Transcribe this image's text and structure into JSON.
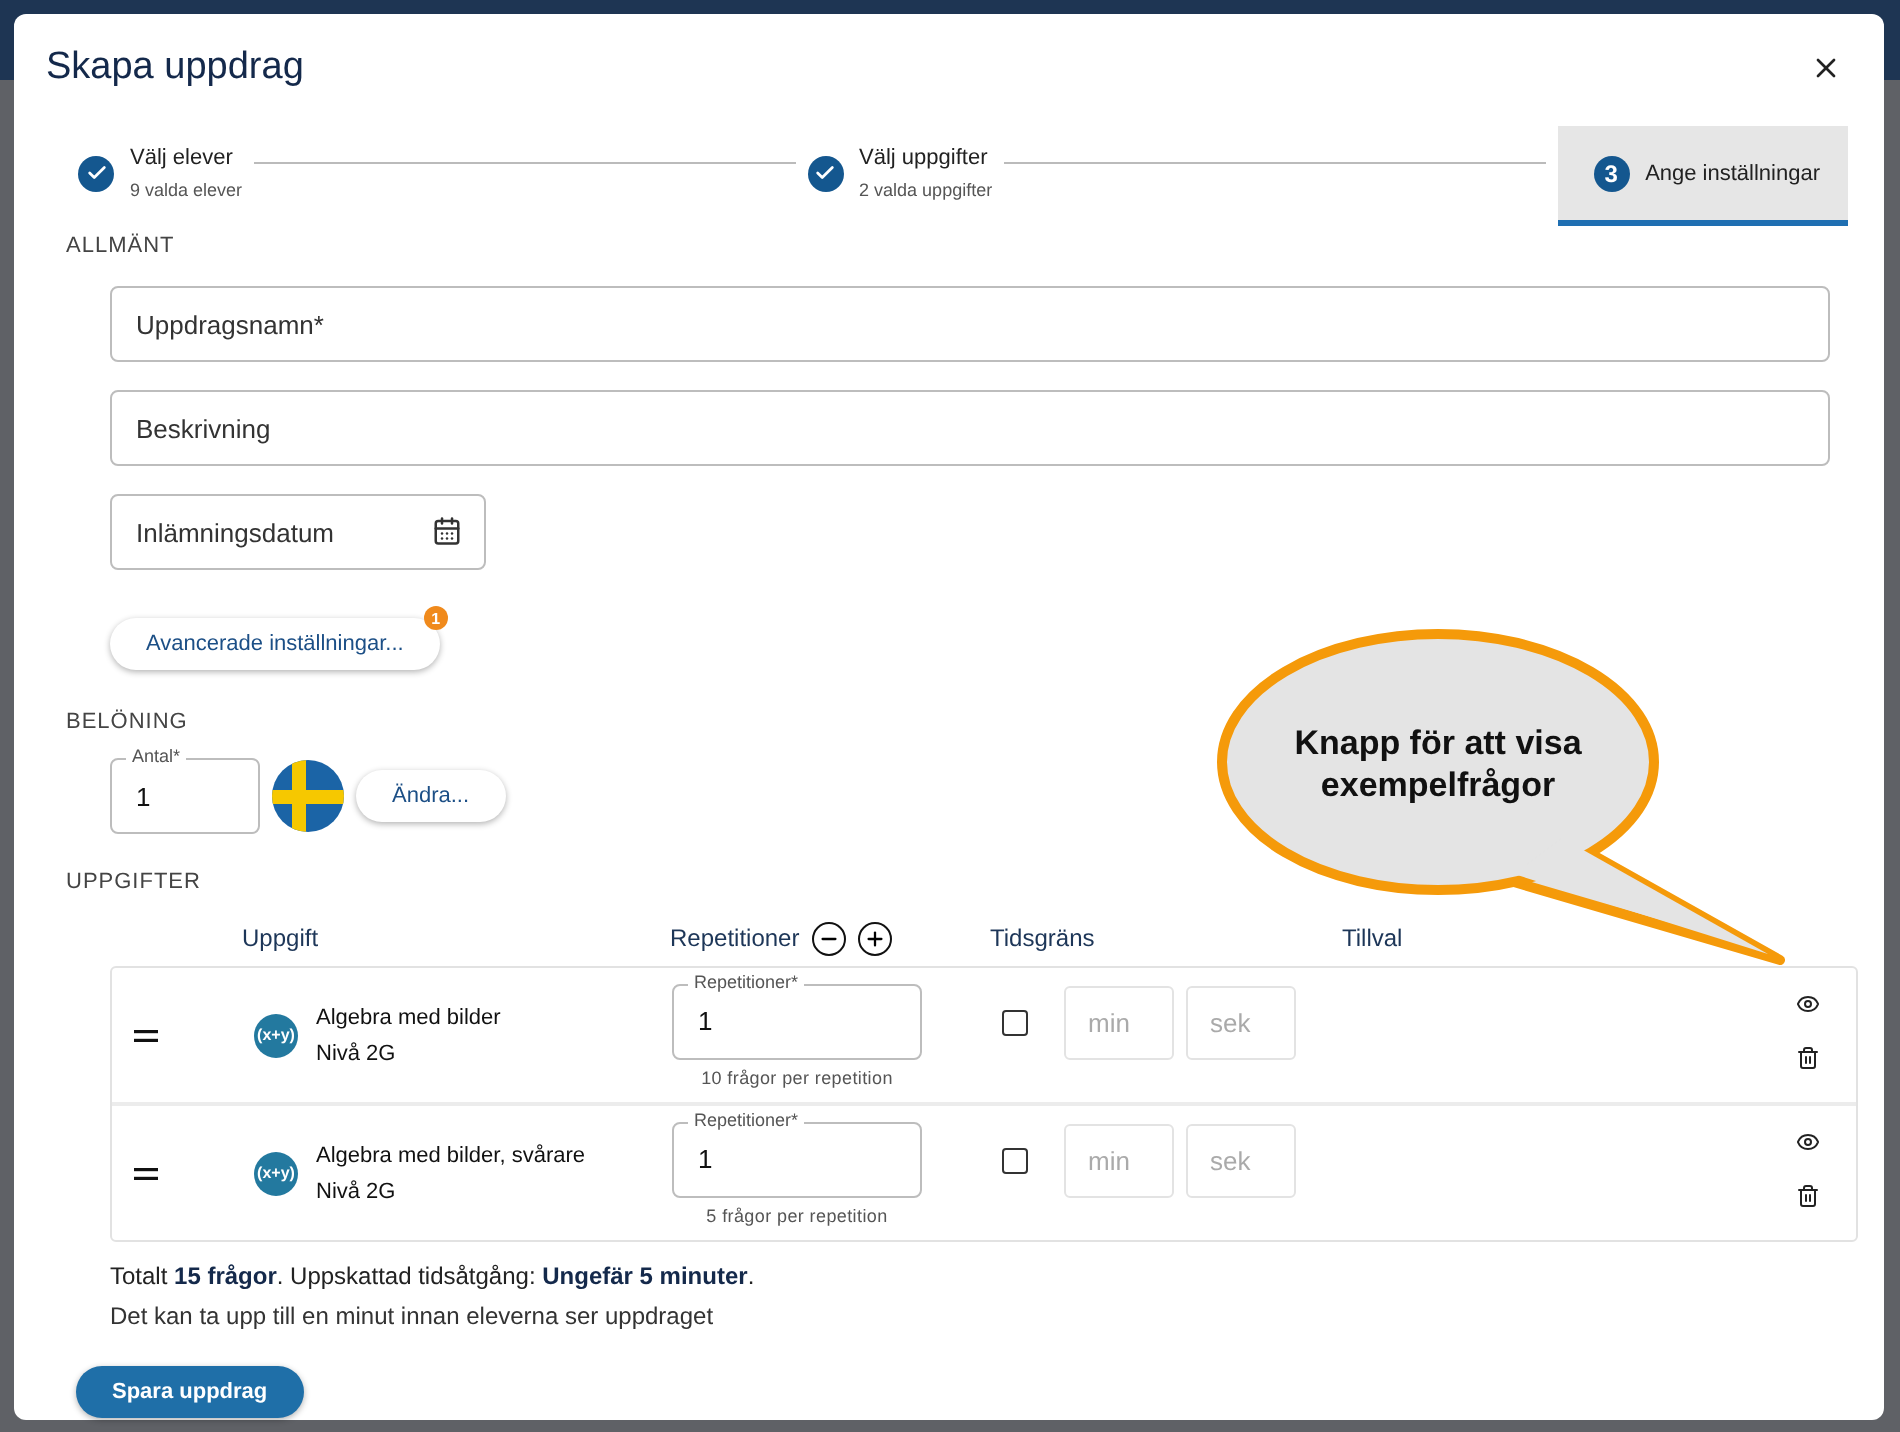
{
  "dialog": {
    "title": "Skapa uppdrag"
  },
  "steps": [
    {
      "label": "Välj elever",
      "sub": "9 valda elever",
      "done": true,
      "selected": false
    },
    {
      "label": "Välj uppgifter",
      "sub": "2 valda uppgifter",
      "done": true,
      "selected": false
    },
    {
      "label": "Ange inställningar",
      "number": "3",
      "done": false,
      "selected": true
    }
  ],
  "general": {
    "heading": "ALLMÄNT",
    "fields": [
      {
        "kind": "text",
        "placeholder": "Uppdragsnamn*"
      },
      {
        "kind": "text",
        "placeholder": "Beskrivning"
      },
      {
        "kind": "date",
        "placeholder": "Inlämningsdatum"
      }
    ],
    "advanced_button": "Avancerade inställningar...",
    "advanced_badge": "1"
  },
  "reward": {
    "heading": "BELÖNING",
    "field_label": "Antal*",
    "value": "1",
    "change_button": "Ändra..."
  },
  "tasks": {
    "heading": "UPPGIFTER",
    "columns": [
      "Uppgift",
      "Repetitioner",
      "Tidsgräns",
      "Tillval"
    ],
    "rows": [
      {
        "icon_text": "(x+y)",
        "name": "Algebra med bilder",
        "level_text": "Nivå 2G",
        "rep_label": "Repetitioner*",
        "rep_value": "1",
        "hint": "10 frågor per repetition",
        "checked": false,
        "min_placeholder": "min",
        "sec_placeholder": "sek"
      },
      {
        "icon_text": "(x+y)",
        "name": "Algebra med bilder, svårare",
        "level_text": "Nivå 2G",
        "rep_label": "Repetitioner*",
        "rep_value": "1",
        "hint": "5 frågor per repetition",
        "checked": false,
        "min_placeholder": "min",
        "sec_placeholder": "sek"
      }
    ]
  },
  "summary": "Totalt **15 frågor**. Uppskattad tidsåtgång: **Ungefär 5 minuter**.",
  "note": "Det kan ta upp till en minut innan eleverna ser uppdraget",
  "save_button": "Spara uppdrag",
  "callout": {
    "text": "Knapp för att visa exempelfrågor"
  }
}
